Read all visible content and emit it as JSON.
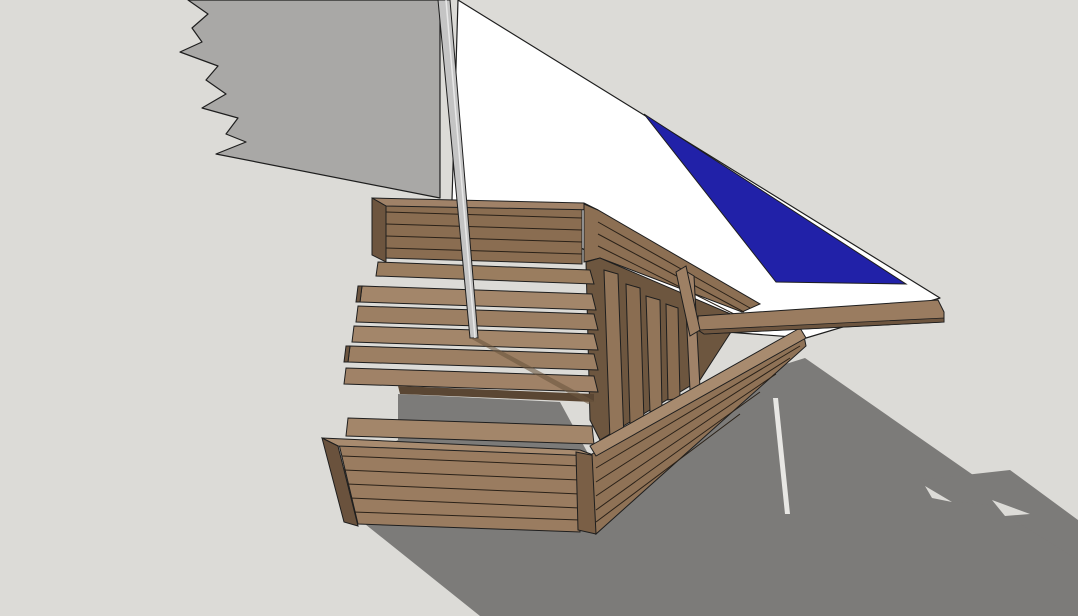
{
  "scene": {
    "subject": "wooden-toy-sailboat-3d-model",
    "colors": {
      "background": "#dcdbd7",
      "ground_shadow": "#7c7b79",
      "wood_light": "#9a7d5e",
      "wood_mid": "#7f6349",
      "wood_dark": "#5f4a36",
      "sail_white": "#ffffff",
      "sail_shadow": "#a9a8a6",
      "sail_blue": "#2121a8",
      "mast": "#c4c4c4",
      "outline": "#1e1e1e"
    }
  }
}
